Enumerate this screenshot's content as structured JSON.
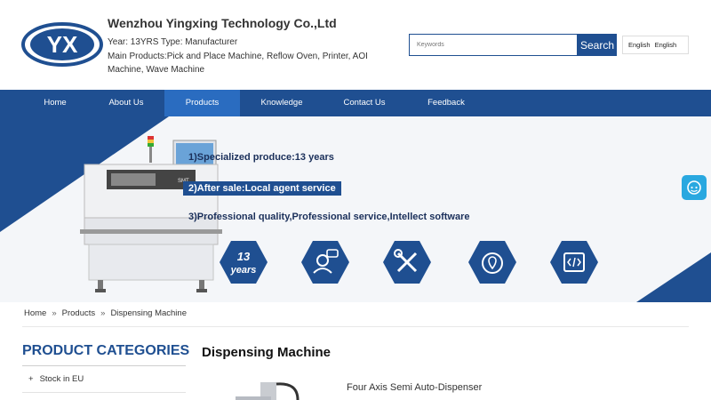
{
  "header": {
    "logo_text": "YX",
    "company": "Wenzhou Yingxing Technology Co.,Ltd",
    "meta_line1": "Year: 13YRS Type: Manufacturer",
    "meta_line2": "Main Products:Pick and Place Machine, Reflow Oven, Printer, AOI Machine, Wave Machine",
    "search_placeholder": "Keywords",
    "search_button": "Search",
    "lang_label": "English",
    "lang_value": "English"
  },
  "nav": {
    "items": [
      {
        "label": "Home"
      },
      {
        "label": "About Us"
      },
      {
        "label": "Products"
      },
      {
        "label": "Knowledge"
      },
      {
        "label": "Contact Us"
      },
      {
        "label": "Feedback"
      }
    ],
    "active": "Products"
  },
  "banner": {
    "line1": "1)Specialized produce:13 years",
    "line2": "2)After sale:Local agent service",
    "line3": "3)Professional quality,Professional service,Intellect software",
    "badge_top": "13",
    "badge_bottom": "years",
    "machine_label": "SMT",
    "icons": [
      "headset-icon",
      "tools-icon",
      "location-icon",
      "code-icon"
    ]
  },
  "breadcrumb": {
    "items": [
      "Home",
      "Products",
      "Dispensing Machine"
    ],
    "separator": "»"
  },
  "sidebar": {
    "title": "PRODUCT CATEGORIES",
    "items": [
      {
        "label": "Stock in EU",
        "marker": "+"
      }
    ]
  },
  "main": {
    "title": "Dispensing Machine",
    "products": [
      {
        "name": "Four Axis Semi Auto-Dispenser"
      }
    ]
  },
  "colors": {
    "brand": "#1f4f91",
    "nav_active": "#2a6cc0",
    "help": "#29a8e0"
  }
}
